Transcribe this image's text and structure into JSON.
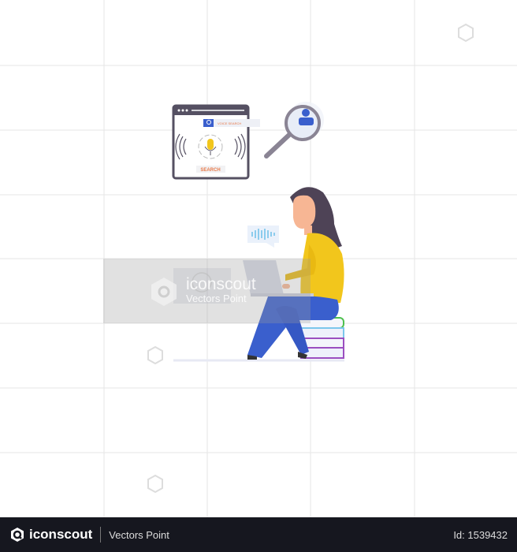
{
  "illustration": {
    "search_box_text": "VOICE SEARCH",
    "search_button": "SEARCH",
    "colors": {
      "hair": "#4e4356",
      "shirt": "#f2c61c",
      "pants": "#3a5fcd",
      "skin": "#f7b694",
      "browser_frame": "#555062",
      "mic": "#f2c61c",
      "accent_blue": "#3a5fcd"
    }
  },
  "watermark": {
    "brand": "iconscout",
    "author": "Vectors Point"
  },
  "footer": {
    "brand": "iconscout",
    "author": "Vectors Point",
    "asset_id": "Id: 1539432",
    "logo_icon": "iconscout-logo-icon"
  }
}
